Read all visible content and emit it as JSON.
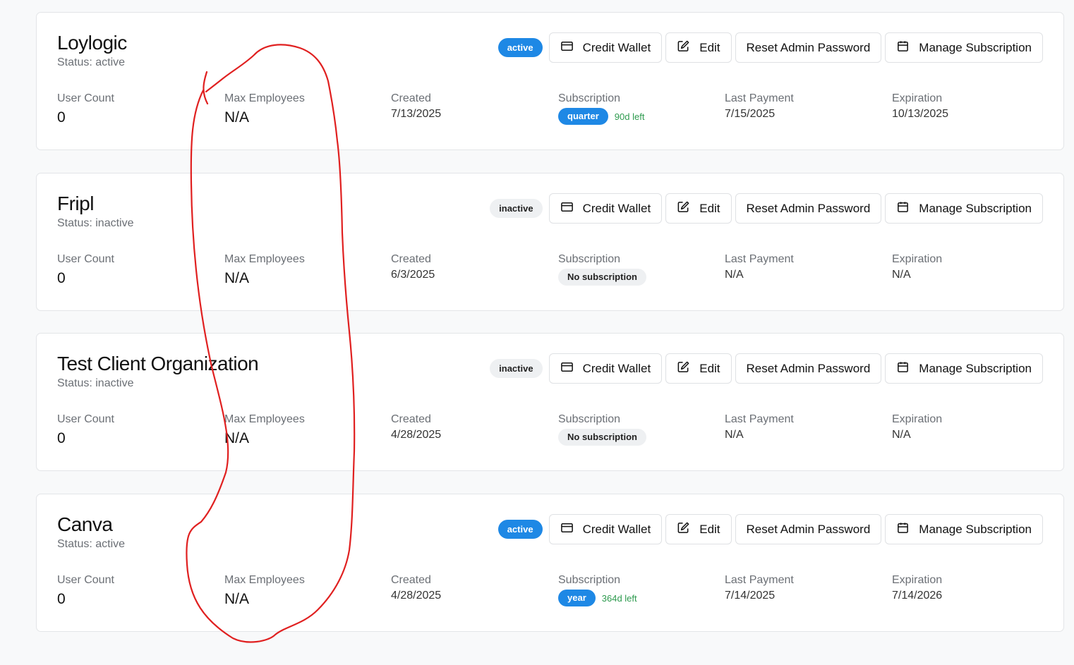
{
  "buttons": {
    "credit_wallet": "Credit Wallet",
    "edit": "Edit",
    "reset_password": "Reset Admin Password",
    "manage_subscription": "Manage Subscription"
  },
  "labels": {
    "user_count": "User Count",
    "max_employees": "Max Employees",
    "created": "Created",
    "subscription": "Subscription",
    "last_payment": "Last Payment",
    "expiration": "Expiration"
  },
  "colors": {
    "active_badge": "#1e88e5",
    "inactive_badge": "#eef0f2",
    "days_left": "#2e9b4f",
    "annotation": "#e02020"
  },
  "icons": {
    "credit_wallet": "credit-card-icon",
    "edit": "edit-icon",
    "manage_subscription": "calendar-icon"
  },
  "organizations": [
    {
      "name": "Loylogic",
      "status_line": "Status: active",
      "badge": "active",
      "user_count": "0",
      "max_employees": "N/A",
      "created": "7/13/2025",
      "subscription": {
        "plan": "quarter",
        "days_left": "90d left"
      },
      "last_payment": "7/15/2025",
      "expiration": "10/13/2025"
    },
    {
      "name": "Fripl",
      "status_line": "Status: inactive",
      "badge": "inactive",
      "user_count": "0",
      "max_employees": "N/A",
      "created": "6/3/2025",
      "subscription": {
        "none_label": "No subscription"
      },
      "last_payment": "N/A",
      "expiration": "N/A"
    },
    {
      "name": "Test Client Organization",
      "status_line": "Status: inactive",
      "badge": "inactive",
      "user_count": "0",
      "max_employees": "N/A",
      "created": "4/28/2025",
      "subscription": {
        "none_label": "No subscription"
      },
      "last_payment": "N/A",
      "expiration": "N/A"
    },
    {
      "name": "Canva",
      "status_line": "Status: active",
      "badge": "active",
      "user_count": "0",
      "max_employees": "N/A",
      "created": "4/28/2025",
      "subscription": {
        "plan": "year",
        "days_left": "364d left"
      },
      "last_payment": "7/14/2025",
      "expiration": "7/14/2026"
    }
  ]
}
